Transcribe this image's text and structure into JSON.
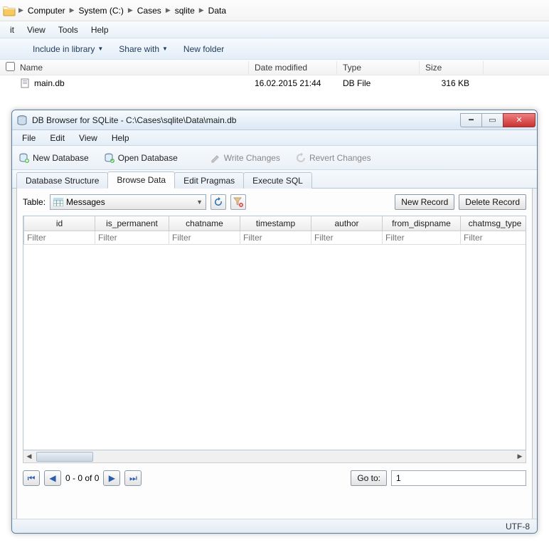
{
  "explorer": {
    "breadcrumb": [
      "Computer",
      "System (C:)",
      "Cases",
      "sqlite",
      "Data"
    ],
    "menu": [
      "it",
      "View",
      "Tools",
      "Help"
    ],
    "toolbar": {
      "include": "Include in library",
      "share": "Share with",
      "newfolder": "New folder"
    },
    "columns": {
      "name": "Name",
      "date": "Date modified",
      "type": "Type",
      "size": "Size"
    },
    "files": [
      {
        "name": "main.db",
        "date": "16.02.2015 21:44",
        "type": "DB File",
        "size": "316 KB"
      }
    ]
  },
  "app": {
    "title": "DB Browser for SQLite - C:\\Cases\\sqlite\\Data\\main.db",
    "menu": [
      "File",
      "Edit",
      "View",
      "Help"
    ],
    "toolbar": {
      "newdb": "New Database",
      "opendb": "Open Database",
      "write": "Write Changes",
      "revert": "Revert Changes"
    },
    "tabs": [
      "Database Structure",
      "Browse Data",
      "Edit Pragmas",
      "Execute SQL"
    ],
    "active_tab": 1,
    "table_label": "Table:",
    "table_selected": "Messages",
    "buttons": {
      "newrec": "New Record",
      "delrec": "Delete Record",
      "goto": "Go to:"
    },
    "grid_columns": [
      "id",
      "is_permanent",
      "chatname",
      "timestamp",
      "author",
      "from_dispname",
      "chatmsg_type"
    ],
    "filter_placeholder": "Filter",
    "pager_text": "0 - 0 of 0",
    "goto_value": "1",
    "status": "UTF-8"
  }
}
